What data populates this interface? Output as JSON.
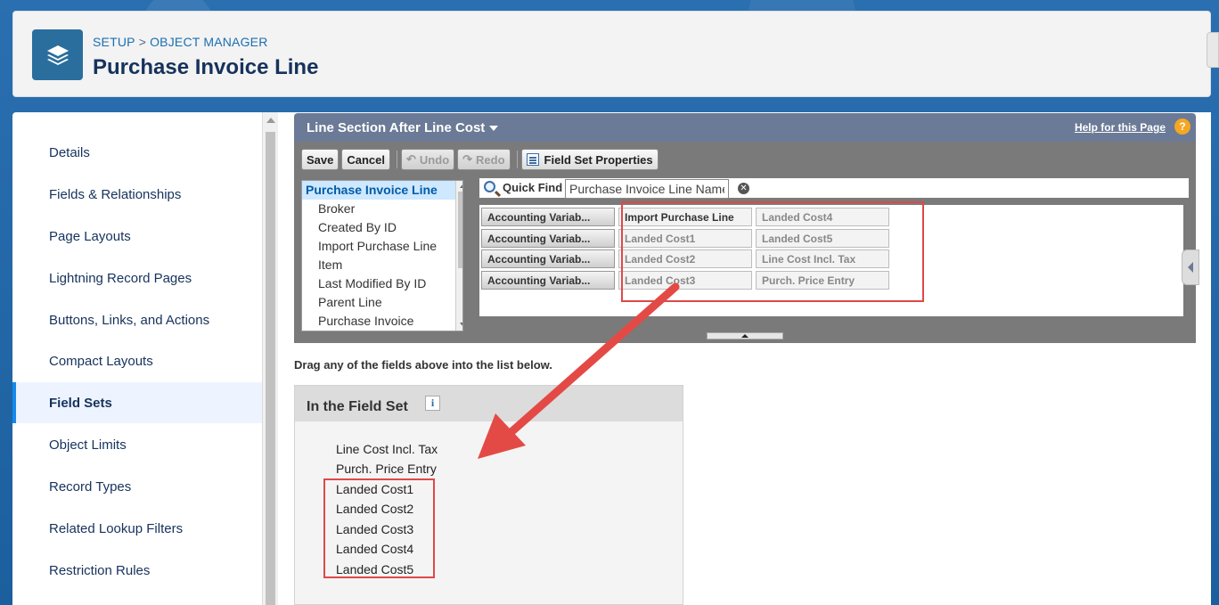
{
  "header": {
    "breadcrumb": [
      "SETUP",
      "OBJECT MANAGER"
    ],
    "breadcrumb_separator": ">",
    "title": "Purchase Invoice Line",
    "icon": "stack-layers-icon"
  },
  "sidebar": {
    "items": [
      {
        "label": "Details",
        "active": false
      },
      {
        "label": "Fields & Relationships",
        "active": false
      },
      {
        "label": "Page Layouts",
        "active": false
      },
      {
        "label": "Lightning Record Pages",
        "active": false
      },
      {
        "label": "Buttons, Links, and Actions",
        "active": false
      },
      {
        "label": "Compact Layouts",
        "active": false
      },
      {
        "label": "Field Sets",
        "active": true
      },
      {
        "label": "Object Limits",
        "active": false
      },
      {
        "label": "Record Types",
        "active": false
      },
      {
        "label": "Related Lookup Filters",
        "active": false
      },
      {
        "label": "Restriction Rules",
        "active": false
      }
    ]
  },
  "fieldset_editor": {
    "title": "Line Section After Line Cost",
    "help_link": "Help for this Page",
    "help_icon": "?",
    "toolbar": {
      "save": "Save",
      "cancel": "Cancel",
      "undo": "Undo",
      "redo": "Redo",
      "properties": "Field Set Properties"
    },
    "object_list": [
      "Purchase Invoice Line",
      "Broker",
      "Created By ID",
      "Import Purchase Line",
      "Item",
      "Last Modified By ID",
      "Parent Line",
      "Purchase Invoice"
    ],
    "quick_find": {
      "label": "Quick Find",
      "value": "Purchase Invoice Line Name",
      "clear": "✕"
    },
    "field_columns": [
      [
        "Accounting Variab...",
        "Accounting Variab...",
        "Accounting Variab...",
        "Accounting Variab..."
      ],
      [
        "Import Purchase Line",
        "Landed Cost1",
        "Landed Cost2",
        "Landed Cost3"
      ],
      [
        "Landed Cost4",
        "Landed Cost5",
        "Line Cost Incl. Tax",
        "Purch. Price Entry"
      ]
    ],
    "drag_instructions": "Drag any of the fields above into the list below.",
    "in_field_set": {
      "title": "In the Field Set",
      "info_icon": "i",
      "fields": [
        "Line Cost Incl. Tax",
        "Purch. Price Entry",
        "Landed Cost1",
        "Landed Cost2",
        "Landed Cost3",
        "Landed Cost4",
        "Landed Cost5"
      ]
    }
  },
  "colors": {
    "accent": "#1589ee",
    "header_bar": "#6b7a96",
    "highlight_red": "#e04848",
    "arrow_red": "#e44a45"
  }
}
